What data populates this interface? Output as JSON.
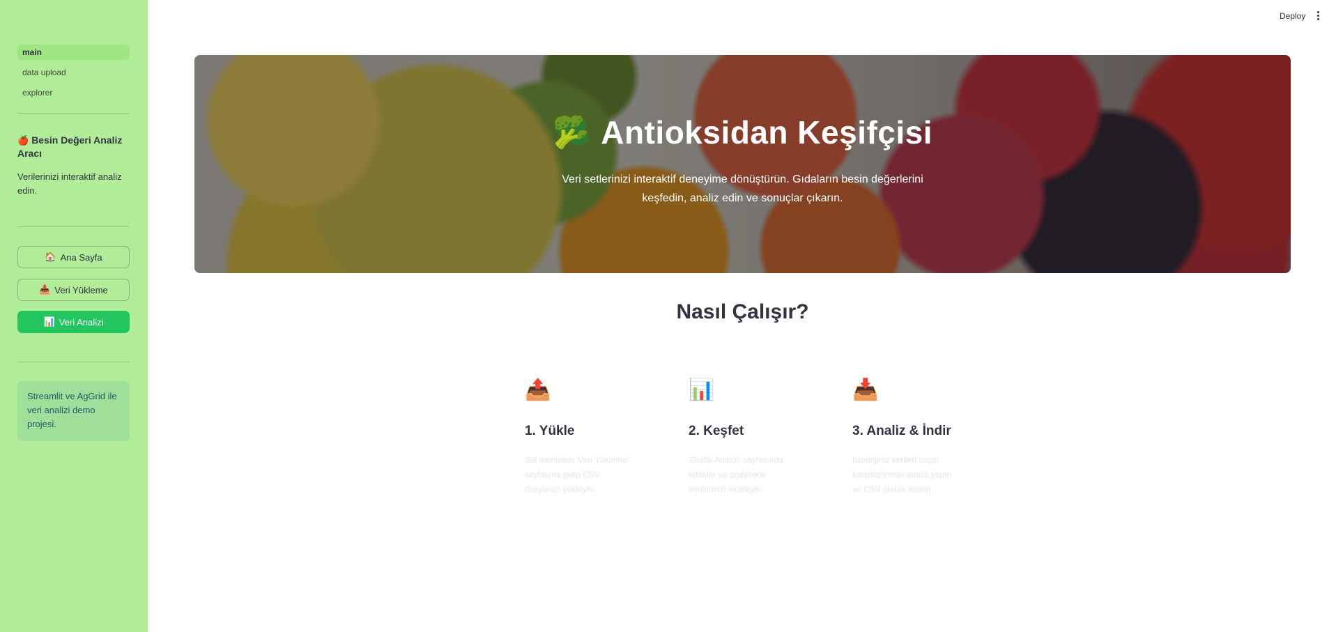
{
  "sidebar": {
    "nav": [
      {
        "label": "main",
        "active": true
      },
      {
        "label": "data upload",
        "active": false
      },
      {
        "label": "explorer",
        "active": false
      }
    ],
    "tool_title": {
      "icon": "🍎",
      "text": "Besin Değeri Analiz Aracı"
    },
    "tool_subtitle": "Verilerinizi interaktif analiz edin.",
    "buttons": [
      {
        "icon": "🏠",
        "label": "Ana Sayfa"
      },
      {
        "icon": "📥",
        "label": "Veri Yükleme"
      },
      {
        "icon": "📊",
        "label": "Veri Analizi"
      }
    ],
    "info": "Streamlit ve AgGrid ile veri analizi demo projesi.",
    "colors": {
      "background": "#b1ed98",
      "primary_button": "#22c55e",
      "info_box": "#9fdf9a"
    }
  },
  "header": {
    "deploy_label": "Deploy",
    "menu_icon": "kebab-menu-icon"
  },
  "hero": {
    "icon": "🥦",
    "title": "Antioksidan Keşifçisi",
    "subtitle": "Veri setlerinizi interaktif deneyime dönüştürün. Gıdaların besin değerlerini keşfedin, analiz edin ve sonuçlar çıkarın."
  },
  "how": {
    "title": "Nasıl Çalışır?",
    "steps": [
      {
        "icon": "📤",
        "title": "1. Yükle",
        "desc": "Sol menüden 'Veri Yükleme' sayfasına gidip CSV dosyanızı yükleyin."
      },
      {
        "icon": "📊",
        "title": "2. Keşfet",
        "desc": "'Grafik Analizi' sayfasında tablolar ve grafiklerle verilerinizi inceleyin."
      },
      {
        "icon": "📥",
        "title": "3. Analiz & İndir",
        "desc": "İstediğiniz verileri seçip karşılaştırmalı analiz yapın ve CSV olarak indirin."
      }
    ]
  }
}
